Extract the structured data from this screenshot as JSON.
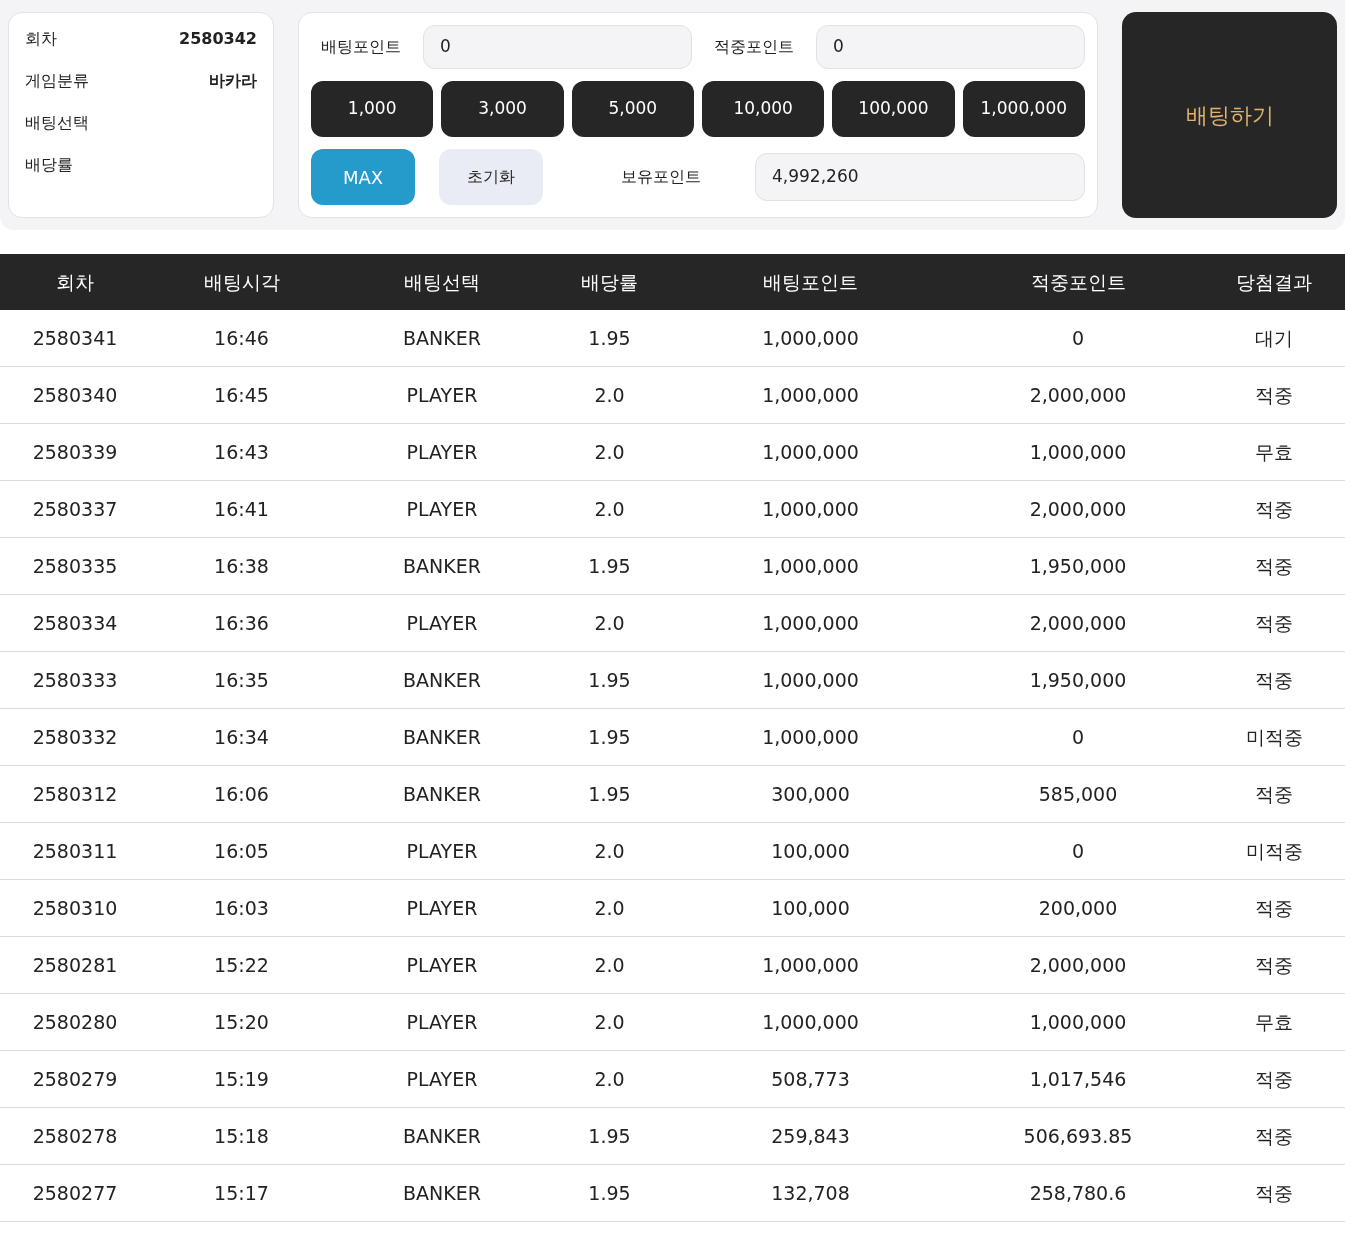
{
  "info": [
    {
      "label": "회차",
      "value": "2580342"
    },
    {
      "label": "게임분류",
      "value": "바카라"
    },
    {
      "label": "배팅선택"
    },
    {
      "label": "배당률"
    }
  ],
  "fields": [
    {
      "label": "배팅포인트",
      "value": "0"
    },
    {
      "label": "적중포인트",
      "value": "0"
    }
  ],
  "amount_buttons": [
    "1,000",
    "3,000",
    "5,000",
    "10,000",
    "100,000",
    "1,000,000"
  ],
  "max_button": "MAX",
  "reset_button": "초기화",
  "held_points": {
    "label": "보유포인트",
    "value": "4,992,260"
  },
  "bet_button": "배팅하기",
  "table": {
    "columns": [
      "회차",
      "배팅시각",
      "배팅선택",
      "배당률",
      "배팅포인트",
      "적중포인트",
      "당첨결과"
    ],
    "rows": [
      [
        "2580341",
        "16:46",
        "BANKER",
        "1.95",
        "1,000,000",
        "0",
        "대기"
      ],
      [
        "2580340",
        "16:45",
        "PLAYER",
        "2.0",
        "1,000,000",
        "2,000,000",
        "적중"
      ],
      [
        "2580339",
        "16:43",
        "PLAYER",
        "2.0",
        "1,000,000",
        "1,000,000",
        "무효"
      ],
      [
        "2580337",
        "16:41",
        "PLAYER",
        "2.0",
        "1,000,000",
        "2,000,000",
        "적중"
      ],
      [
        "2580335",
        "16:38",
        "BANKER",
        "1.95",
        "1,000,000",
        "1,950,000",
        "적중"
      ],
      [
        "2580334",
        "16:36",
        "PLAYER",
        "2.0",
        "1,000,000",
        "2,000,000",
        "적중"
      ],
      [
        "2580333",
        "16:35",
        "BANKER",
        "1.95",
        "1,000,000",
        "1,950,000",
        "적중"
      ],
      [
        "2580332",
        "16:34",
        "BANKER",
        "1.95",
        "1,000,000",
        "0",
        "미적중"
      ],
      [
        "2580312",
        "16:06",
        "BANKER",
        "1.95",
        "300,000",
        "585,000",
        "적중"
      ],
      [
        "2580311",
        "16:05",
        "PLAYER",
        "2.0",
        "100,000",
        "0",
        "미적중"
      ],
      [
        "2580310",
        "16:03",
        "PLAYER",
        "2.0",
        "100,000",
        "200,000",
        "적중"
      ],
      [
        "2580281",
        "15:22",
        "PLAYER",
        "2.0",
        "1,000,000",
        "2,000,000",
        "적중"
      ],
      [
        "2580280",
        "15:20",
        "PLAYER",
        "2.0",
        "1,000,000",
        "1,000,000",
        "무효"
      ],
      [
        "2580279",
        "15:19",
        "PLAYER",
        "2.0",
        "508,773",
        "1,017,546",
        "적중"
      ],
      [
        "2580278",
        "15:18",
        "BANKER",
        "1.95",
        "259,843",
        "506,693.85",
        "적중"
      ],
      [
        "2580277",
        "15:17",
        "BANKER",
        "1.95",
        "132,708",
        "258,780.6",
        "적중"
      ]
    ]
  }
}
